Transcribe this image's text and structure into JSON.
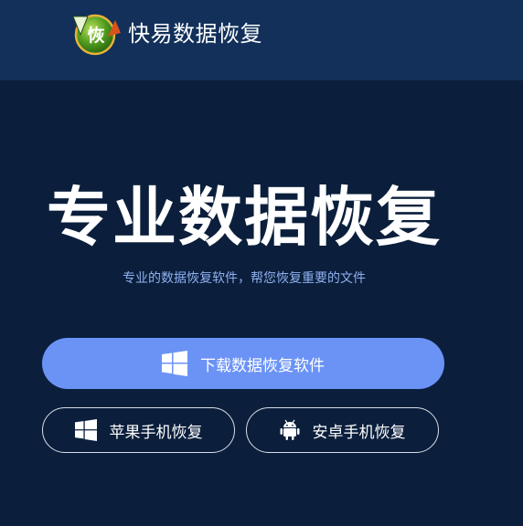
{
  "header": {
    "logo_icon": "recovery-logo-icon",
    "logo_glyph": "恢",
    "brand_name": "快易数据恢复"
  },
  "hero": {
    "title": "专业数据恢复",
    "subtitle": "专业的数据恢复软件，帮您恢复重要的文件"
  },
  "buttons": {
    "download": {
      "label": "下载数据恢复软件",
      "icon": "windows-icon",
      "color": "#6b93f6"
    },
    "apple": {
      "label": "苹果手机恢复",
      "icon": "windows-icon"
    },
    "android": {
      "label": "安卓手机恢复",
      "icon": "android-icon"
    }
  },
  "colors": {
    "header_bg": "#12305a",
    "page_bg": "#0b1f3c",
    "subtitle": "#8fb0f0"
  }
}
